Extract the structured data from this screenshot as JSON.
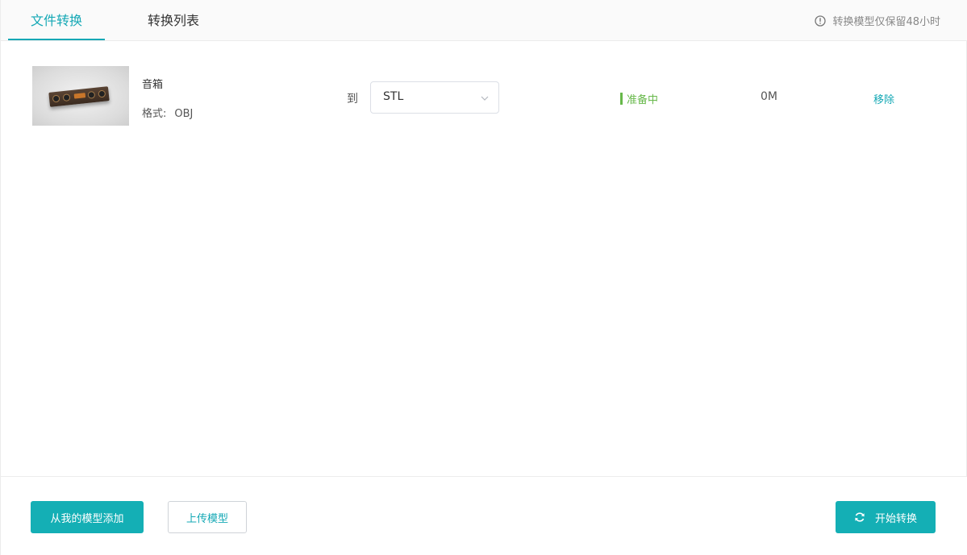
{
  "tabs": [
    {
      "label": "文件转换",
      "active": true
    },
    {
      "label": "转换列表",
      "active": false
    }
  ],
  "notice": {
    "text": "转换模型仅保留48小时",
    "icon": "info-icon"
  },
  "file": {
    "name": "音箱",
    "format_label": "格式:",
    "format_value": "OBJ",
    "to_label": "到",
    "target_format": "STL",
    "status": "准备中",
    "size": "0M",
    "remove_label": "移除"
  },
  "footer": {
    "add_from_models": "从我的模型添加",
    "upload_model": "上传模型",
    "start_convert": "开始转换"
  },
  "colors": {
    "accent": "#14a8b5",
    "status_ready": "#67b84a",
    "primary_button": "#14afb5"
  }
}
